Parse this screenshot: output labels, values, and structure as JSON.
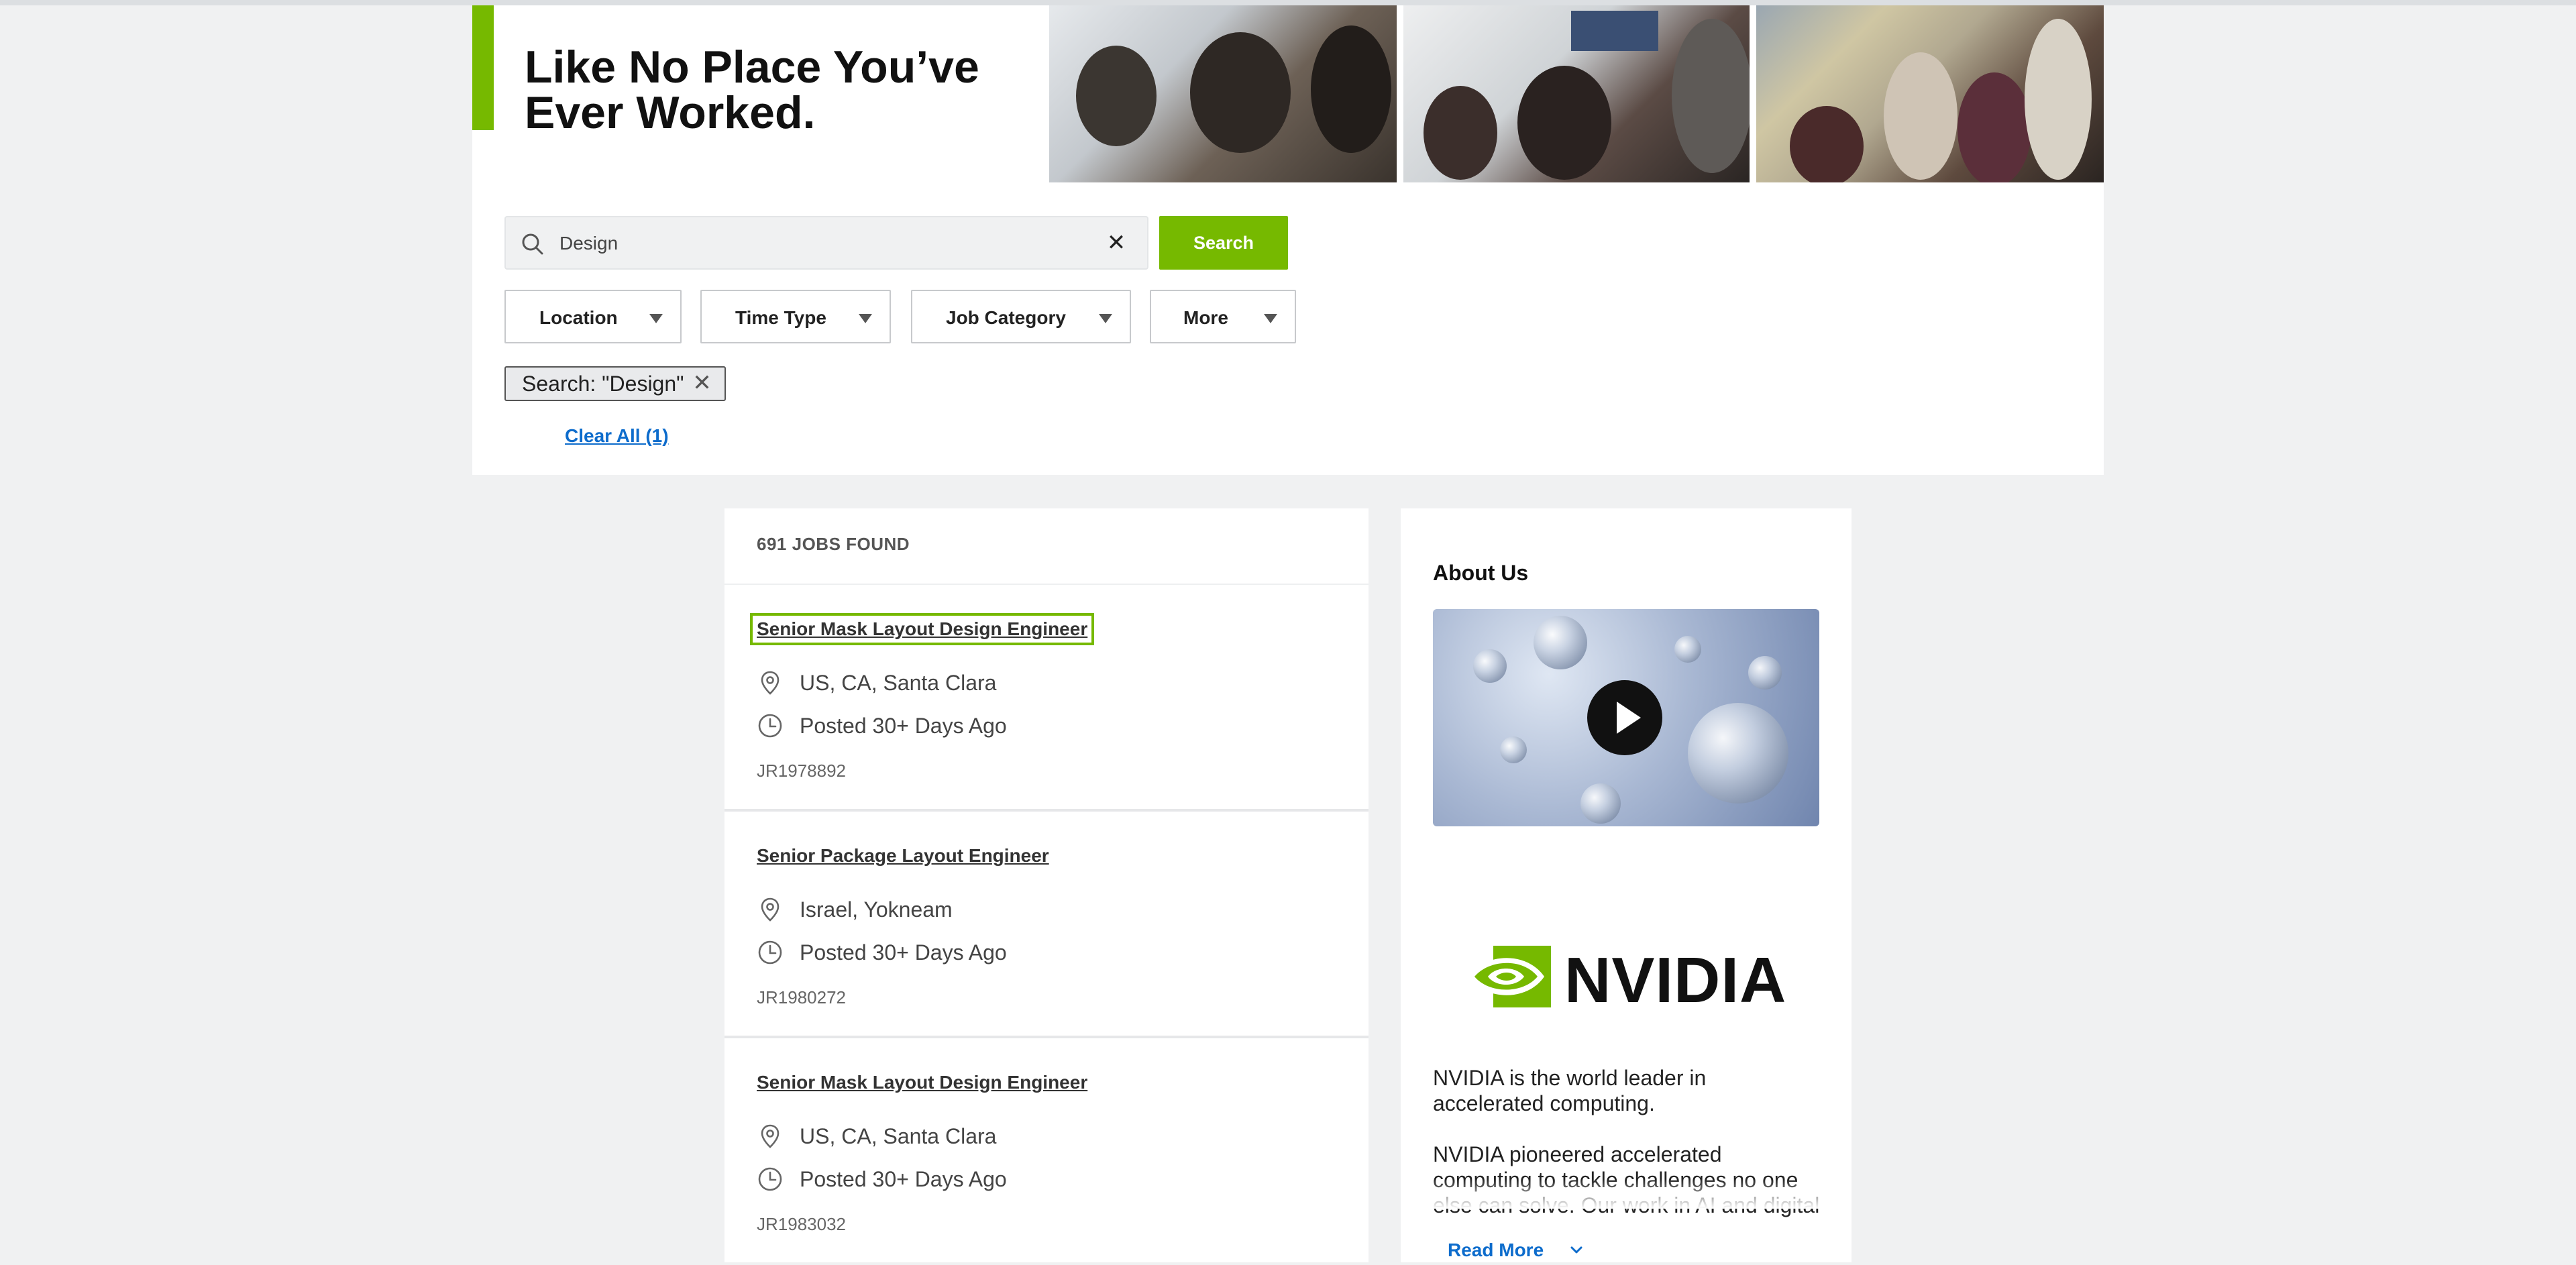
{
  "hero": {
    "title": "Like No Place You’ve Ever Worked."
  },
  "search": {
    "value": "Design",
    "button_label": "Search"
  },
  "filters": [
    {
      "label": "Location"
    },
    {
      "label": "Time Type"
    },
    {
      "label": "Job Category"
    },
    {
      "label": "More"
    }
  ],
  "active_chip": {
    "label": "Search: \"Design\""
  },
  "clear_all_label": "Clear All (1)",
  "results": {
    "count_label": "691 JOBS FOUND",
    "jobs": [
      {
        "title": "Senior Mask Layout Design Engineer",
        "location": "US, CA, Santa Clara",
        "posted": "Posted 30+ Days Ago",
        "id": "JR1978892"
      },
      {
        "title": "Senior Package Layout Engineer",
        "location": "Israel, Yokneam",
        "posted": "Posted 30+ Days Ago",
        "id": "JR1980272"
      },
      {
        "title": "Senior Mask Layout Design Engineer",
        "location": "US, CA, Santa Clara",
        "posted": "Posted 30+ Days Ago",
        "id": "JR1983032"
      }
    ]
  },
  "about": {
    "title": "About Us",
    "logo_text": "NVIDIA",
    "paragraph_1": "NVIDIA is the world leader in accelerated computing.",
    "paragraph_2": "NVIDIA pioneered accelerated computing to tackle challenges no one else can solve. Our work in AI and digital",
    "read_more_label": "Read More"
  },
  "colors": {
    "brand_green": "#76b900",
    "link_blue": "#0d6ccc",
    "page_bg": "#f0f1f2"
  },
  "icons": {
    "search": "search-icon",
    "clear": "close-icon",
    "location": "location-pin-icon",
    "posted": "clock-icon",
    "play": "play-icon",
    "read_more": "chevron-down-icon"
  }
}
